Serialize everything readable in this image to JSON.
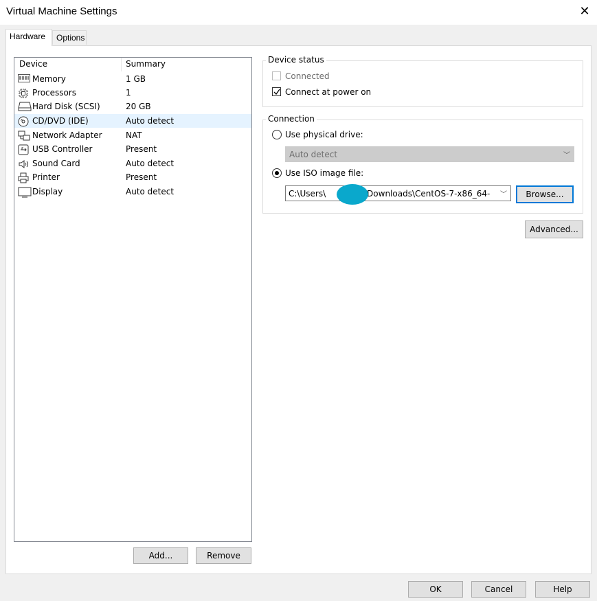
{
  "window": {
    "title": "Virtual Machine Settings"
  },
  "tabs": [
    {
      "label": "Hardware"
    },
    {
      "label": "Options"
    }
  ],
  "device_list": {
    "columns": {
      "device": "Device",
      "summary": "Summary"
    },
    "rows": [
      {
        "icon": "memory-icon",
        "name": "Memory",
        "summary": "1 GB"
      },
      {
        "icon": "processor-icon",
        "name": "Processors",
        "summary": "1"
      },
      {
        "icon": "hard-disk-icon",
        "name": "Hard Disk (SCSI)",
        "summary": "20 GB"
      },
      {
        "icon": "cd-dvd-icon",
        "name": "CD/DVD (IDE)",
        "summary": "Auto detect",
        "selected": true
      },
      {
        "icon": "network-adapter-icon",
        "name": "Network Adapter",
        "summary": "NAT"
      },
      {
        "icon": "usb-icon",
        "name": "USB Controller",
        "summary": "Present"
      },
      {
        "icon": "speaker-icon",
        "name": "Sound Card",
        "summary": "Auto detect"
      },
      {
        "icon": "printer-icon",
        "name": "Printer",
        "summary": "Present"
      },
      {
        "icon": "display-icon",
        "name": "Display",
        "summary": "Auto detect"
      }
    ]
  },
  "list_buttons": {
    "add": "Add...",
    "remove": "Remove"
  },
  "device_status": {
    "legend": "Device status",
    "connected": {
      "label": "Connected",
      "checked": false,
      "disabled": true
    },
    "connect_at_power_on": {
      "label": "Connect at power on",
      "checked": true
    }
  },
  "connection": {
    "legend": "Connection",
    "physical_drive": {
      "label": "Use physical drive:",
      "selected": false,
      "value": "Auto detect"
    },
    "iso_image": {
      "label": "Use ISO image file:",
      "selected": true,
      "path_prefix": "C:\\Users\\",
      "path_suffix": "\\Downloads\\CentOS-7-x86_64-"
    },
    "browse_label": "Browse..."
  },
  "advanced_label": "Advanced...",
  "footer": {
    "ok": "OK",
    "cancel": "Cancel",
    "help": "Help"
  },
  "colors": {
    "selection": "#e5f3ff",
    "focus_border": "#0078d7",
    "redaction": "#0aa8cc"
  }
}
